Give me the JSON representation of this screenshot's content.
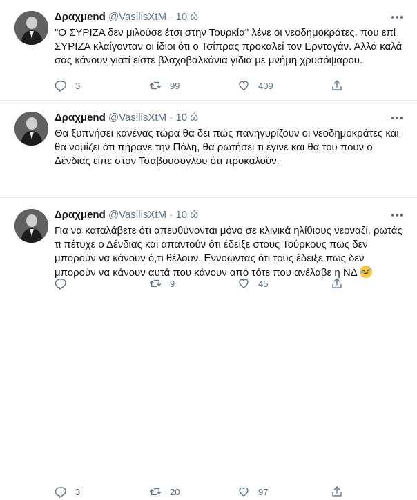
{
  "tweets": [
    {
      "name": "Δραχμend",
      "handle": "@VasilisXtM",
      "dot": "·",
      "time": "10 ώ",
      "text": "\"Ο ΣΥΡΙΖΑ δεν μιλούσε έτσι στην Τουρκία\" λένε οι νεοδημοκράτες, που επί ΣΥΡΙΖΑ κλαίγονταν οι ίδιοι ότι ο Τσίπρας προκαλεί τον Ερντογάν. Αλλά καλά σας κάνουν γιατί είστε βλαχοβαλκάνια γίδια με μνήμη χρυσόψαρου.",
      "replies": "3",
      "retweets": "99",
      "likes": "409"
    },
    {
      "name": "Δραχμend",
      "handle": "@VasilisXtM",
      "dot": "·",
      "time": "10 ώ",
      "text": "Θα ξυπνήσει κανένας τώρα θα δει πώς πανηγυρίζουν οι νεοδημοκράτες και θα νομίζει ότι πήρανε την Πόλη, θα ρωτήσει τι έγινε και θα του πουν ο Δένδιας είπε στον Τσαβουσογλου ότι προκαλούν.",
      "replies": "",
      "retweets": "9",
      "likes": "45"
    },
    {
      "name": "Δραχμend",
      "handle": "@VasilisXtM",
      "dot": "·",
      "time": "10 ώ",
      "text": "Για να καταλάβετε ότι απευθύνονται μόνο σε κλινικά ηλίθιους νεοναζί, ρωτάς τι πέτυχε ο Δένδιας και απαντούν ότι έδειξε στους Τούρκους πως δεν μπορούν να κάνουν ό,τι θέλουν. Εννοώντας ότι τους έδειξε πως δεν μπορούν να κάνουν αυτά που κάνουν από τότε που ανέλαβε η ΝΔ",
      "emoji": "rolling-on-floor-laughing-emoji",
      "replies": "3",
      "retweets": "20",
      "likes": "97"
    }
  ],
  "icons": {
    "reply": "reply-icon",
    "retweet": "retweet-icon",
    "like": "heart-icon",
    "share": "share-icon",
    "more": "more-icon"
  },
  "colors": {
    "text": "#0f1419",
    "secondary": "#5b7083",
    "divider": "#e6ecf0"
  }
}
